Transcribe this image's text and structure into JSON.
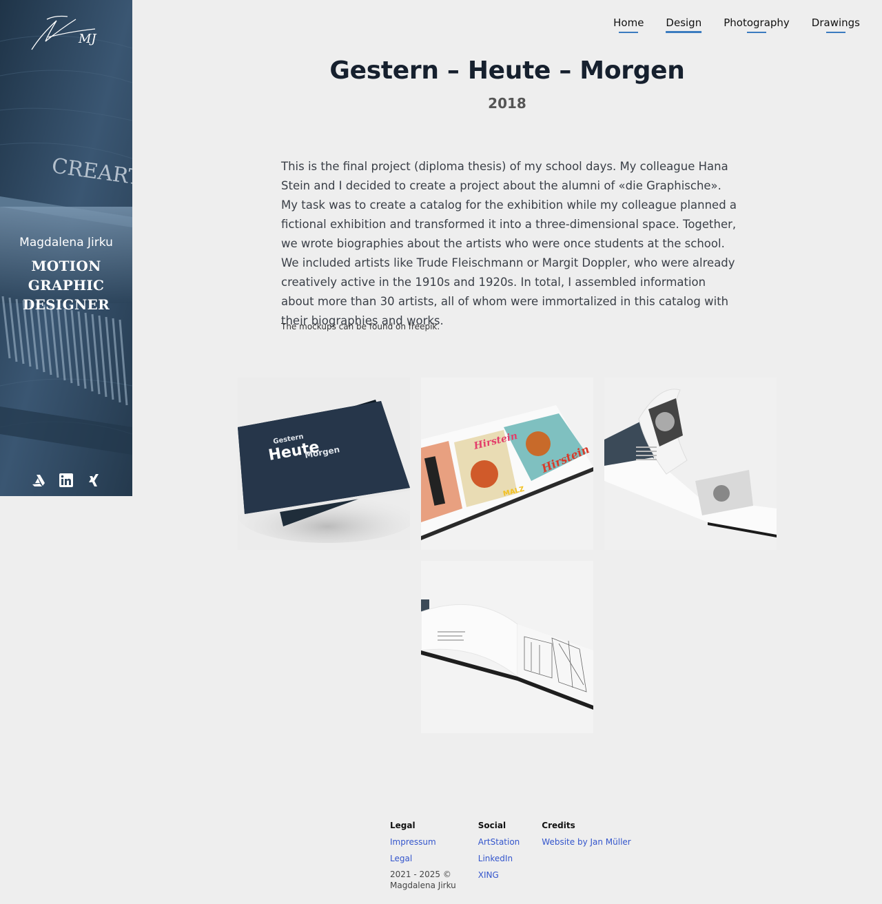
{
  "sidebar": {
    "logo_text": "MJ",
    "name": "Magdalena Jirku",
    "role": "MOTION GRAPHIC DESIGNER",
    "background_text": "CREARTE",
    "social_icons": [
      "artstation-icon",
      "linkedin-icon",
      "xing-icon"
    ]
  },
  "nav": {
    "items": [
      {
        "label": "Home"
      },
      {
        "label": "Design"
      },
      {
        "label": "Photography"
      },
      {
        "label": "Drawings"
      }
    ],
    "active": "Design"
  },
  "project": {
    "title": "Gestern – Heute – Morgen",
    "year": "2018",
    "description": "This is the final project (diploma thesis) of my school days. My colleague Hana Stein and I decided to create a project about the alumni of «die Graphische». My task was to create a catalog for the exhibition while my colleague planned a fictional exhibition and transformed it into a three-dimensional space. Together, we wrote biographies about the artists who were once students at the school. We included artists like Trude Fleischmann or Margit Doppler, who were already creatively active in the 1910s and 1920s. In total, I assembled information about more than 30 artists, all of whom were immortalized in this catalog with their biographies and works.",
    "note": "The mockups can be found on freepik."
  },
  "gallery": {
    "cover": {
      "line1": "Gestern",
      "line2": "Heute",
      "line3": "Morgen"
    },
    "poster_text": "Hirstein",
    "poster_sub": "MALZ"
  },
  "footer": {
    "legal": {
      "heading": "Legal",
      "links": [
        "Impressum",
        "Legal"
      ],
      "copyright_line1": "2021 - 2025 ©",
      "copyright_line2": "Magdalena Jirku"
    },
    "social": {
      "heading": "Social",
      "links": [
        "ArtStation",
        "LinkedIn",
        "XING"
      ]
    },
    "credits": {
      "heading": "Credits",
      "links": [
        "Website by Jan Müller"
      ]
    }
  },
  "colors": {
    "accent": "#3a7bbf",
    "link": "#3355cc",
    "background": "#eeeeee",
    "sidebar": "#2f475e"
  }
}
